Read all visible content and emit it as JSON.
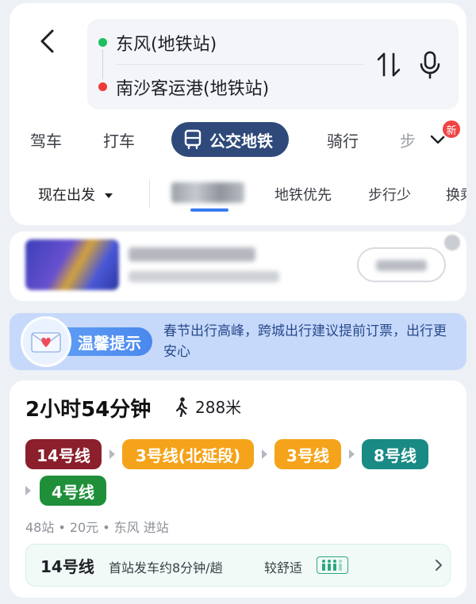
{
  "route": {
    "from": "东风(地铁站)",
    "to": "南沙客运港(地铁站)"
  },
  "modes": {
    "drive": "驾车",
    "taxi": "打车",
    "transit": "公交地铁",
    "ride": "骑行",
    "walk": "步",
    "new_badge": "新"
  },
  "prefs": {
    "depart": "现在出发",
    "subway_first": "地铁优先",
    "less_walk": "步行少",
    "transfer": "换乘"
  },
  "tip": {
    "label": "温馨提示",
    "text": "春节出行高峰，跨城出行建议提前订票，出行更安心"
  },
  "plan": {
    "duration": "2小时54分钟",
    "walk_distance": "288米",
    "lines": [
      {
        "name": "14号线",
        "color": "#8b1f2c"
      },
      {
        "name": "3号线(北延段)",
        "color": "#f5a31a"
      },
      {
        "name": "3号线",
        "color": "#f5a31a"
      },
      {
        "name": "8号线",
        "color": "#1a8a85"
      },
      {
        "name": "4号线",
        "color": "#1f8f3a"
      }
    ],
    "meta": {
      "stations": "48站",
      "price": "20元",
      "entry": "东风 进站"
    },
    "next": {
      "line": "14号线",
      "frequency": "首站发车约8分钟/趟",
      "comfort": "较舒适"
    }
  },
  "icons": {
    "back": "back-arrow-icon",
    "swap": "swap-icon",
    "mic": "microphone-icon",
    "bus": "bus-icon",
    "chevron_down": "chevron-down-icon",
    "walk": "walking-person-icon",
    "chevron_right": "chevron-right-icon"
  }
}
